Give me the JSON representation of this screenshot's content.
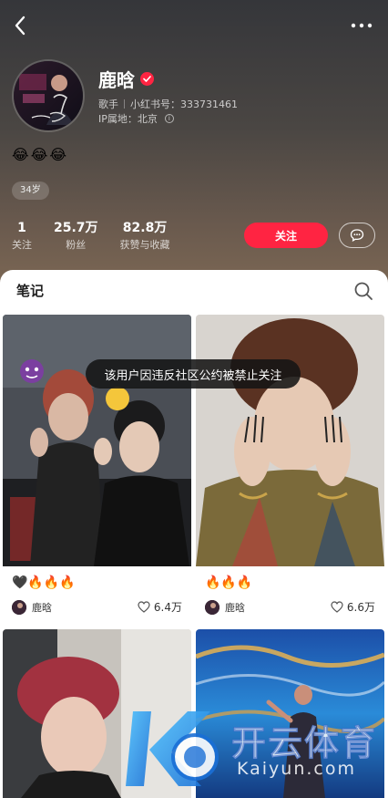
{
  "profile": {
    "name": "鹿晗",
    "role": "歌手",
    "id_label": "小红书号：333731461",
    "ip_label": "IP属地：北京",
    "bio": "😂😂😂",
    "age_tag": "34岁"
  },
  "stats": [
    {
      "value": "1",
      "label": "关注"
    },
    {
      "value": "25.7万",
      "label": "粉丝"
    },
    {
      "value": "82.8万",
      "label": "获赞与收藏"
    }
  ],
  "actions": {
    "follow_label": "关注"
  },
  "tab": {
    "notes_label": "笔记"
  },
  "toast": "该用户因违反社区公约被禁止关注",
  "notes": [
    {
      "title": "🖤🔥🔥🔥",
      "author": "鹿晗",
      "likes": "6.4万"
    },
    {
      "title": "🔥🔥🔥",
      "author": "鹿晗",
      "likes": "6.6万"
    }
  ],
  "watermark": {
    "brand": "开云体育",
    "url": "Kaiyun.com"
  },
  "colors": {
    "accent": "#ff2442"
  }
}
